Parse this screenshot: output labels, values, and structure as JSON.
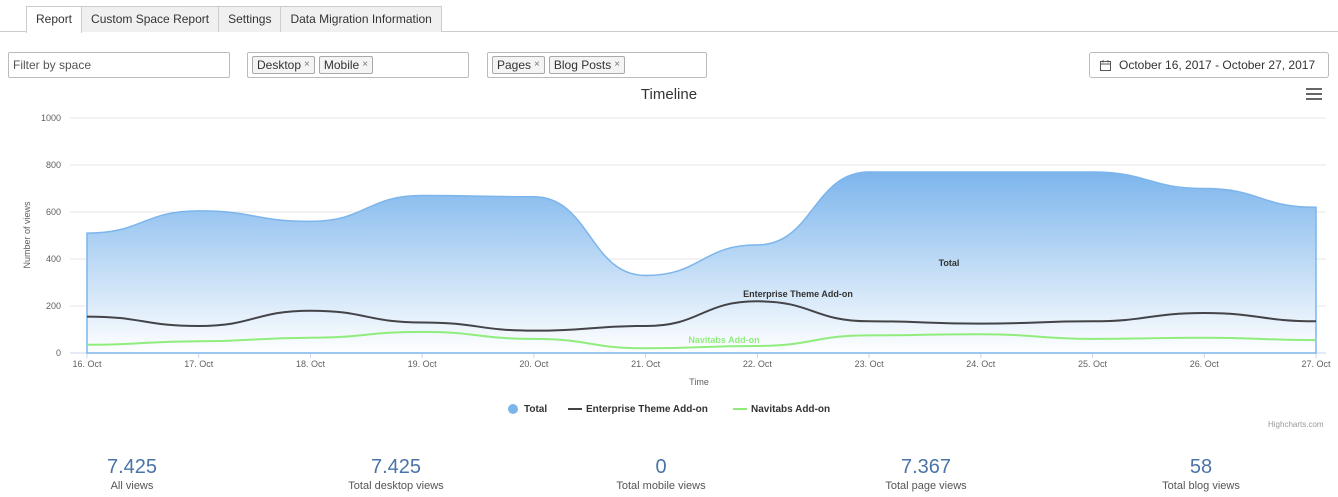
{
  "tabs": [
    {
      "label": "Report",
      "active": true
    },
    {
      "label": "Custom Space Report",
      "active": false
    },
    {
      "label": "Settings",
      "active": false
    },
    {
      "label": "Data Migration Information",
      "active": false
    }
  ],
  "filters": {
    "space_placeholder": "Filter by space",
    "platform_chips": [
      "Desktop",
      "Mobile"
    ],
    "content_chips": [
      "Pages",
      "Blog Posts"
    ],
    "chip_remove_glyph": "×",
    "date_range": "October 16, 2017 - October 27, 2017"
  },
  "chart_data": {
    "type": "area",
    "title": "Timeline",
    "xlabel": "Time",
    "ylabel": "Number of views",
    "ylim": [
      0,
      1000
    ],
    "yticks": [
      0,
      200,
      400,
      600,
      800,
      1000
    ],
    "categories": [
      "16. Oct",
      "17. Oct",
      "18. Oct",
      "19. Oct",
      "20. Oct",
      "21. Oct",
      "22. Oct",
      "23. Oct",
      "24. Oct",
      "25. Oct",
      "26. Oct",
      "27. Oct"
    ],
    "series": [
      {
        "name": "Total",
        "type": "area",
        "color": "#7cb5ec",
        "values": [
          510,
          605,
          560,
          670,
          665,
          330,
          460,
          770,
          770,
          770,
          700,
          620
        ]
      },
      {
        "name": "Enterprise Theme Add-on",
        "type": "line",
        "color": "#434348",
        "values": [
          155,
          115,
          180,
          130,
          95,
          115,
          220,
          135,
          125,
          135,
          170,
          135
        ]
      },
      {
        "name": "Navitabs Add-on",
        "type": "line",
        "color": "#90ed7d",
        "values": [
          35,
          50,
          65,
          90,
          60,
          20,
          30,
          75,
          80,
          60,
          65,
          55
        ]
      }
    ],
    "series_labels": {
      "total": "Total",
      "enterprise": "Enterprise Theme Add-on",
      "navitabs": "Navitabs Add-on"
    },
    "legend_position": "bottom-center",
    "grid": true
  },
  "credits": "Highcharts.com",
  "stats": [
    {
      "value": "7.425",
      "label": "All views"
    },
    {
      "value": "7.425",
      "label": "Total desktop views"
    },
    {
      "value": "0",
      "label": "Total mobile views"
    },
    {
      "value": "7.367",
      "label": "Total page views"
    },
    {
      "value": "58",
      "label": "Total blog views"
    }
  ]
}
